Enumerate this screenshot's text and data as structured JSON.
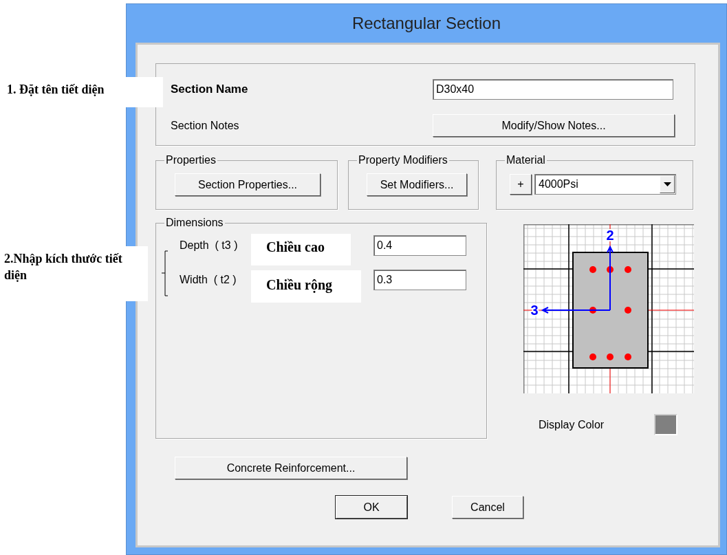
{
  "window": {
    "title": "Rectangular Section"
  },
  "section_name": {
    "label": "Section Name",
    "value": "D30x40"
  },
  "section_notes": {
    "label": "Section Notes",
    "button": "Modify/Show Notes..."
  },
  "properties": {
    "title": "Properties",
    "button": "Section Properties..."
  },
  "property_modifiers": {
    "title": "Property Modifiers",
    "button": "Set Modifiers..."
  },
  "material": {
    "title": "Material",
    "add_button": "+",
    "value": "4000Psi"
  },
  "dimensions": {
    "title": "Dimensions",
    "fields": [
      {
        "label": "Depth  ( t3 )",
        "value": "0.4"
      },
      {
        "label": "Width  ( t2 )",
        "value": "0.3"
      }
    ]
  },
  "preview": {
    "axis_vertical": "2",
    "axis_horizontal": "3"
  },
  "display_color": {
    "label": "Display Color",
    "color": "#808080"
  },
  "concrete_button": "Concrete Reinforcement...",
  "buttons": [
    {
      "label": "OK",
      "default": true
    },
    {
      "label": "Cancel",
      "default": false
    }
  ],
  "annotations": [
    {
      "kind": "step",
      "text": "1. Đặt tên tiết diện"
    },
    {
      "kind": "step",
      "text": "2.Nhập kích thước tiết diện"
    },
    {
      "kind": "note",
      "text": "Chiều cao"
    },
    {
      "kind": "note",
      "text": "Chiều rộng"
    }
  ]
}
